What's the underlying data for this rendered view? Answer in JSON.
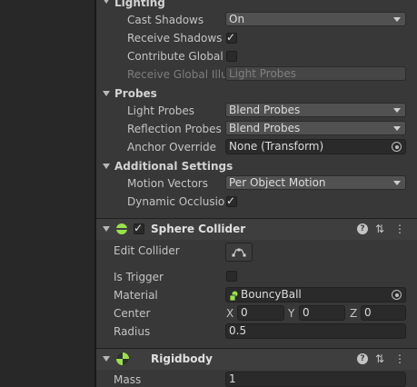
{
  "colors": {
    "accent_green": "#9be04d",
    "panel_bg": "#383838",
    "field_bg": "#2a2a2a"
  },
  "mesh_renderer": {
    "lighting": {
      "title": "Lighting",
      "cast_shadows": {
        "label": "Cast Shadows",
        "value": "On"
      },
      "receive_shadows": {
        "label": "Receive Shadows",
        "checked": true
      },
      "contribute_gi": {
        "label": "Contribute Global Il",
        "checked": false
      },
      "receive_gi": {
        "label": "Receive Global Illur",
        "value": "Light Probes"
      }
    },
    "probes": {
      "title": "Probes",
      "light_probes": {
        "label": "Light Probes",
        "value": "Blend Probes"
      },
      "reflection_probes": {
        "label": "Reflection Probes",
        "value": "Blend Probes"
      },
      "anchor_override": {
        "label": "Anchor Override",
        "value": "None (Transform)"
      }
    },
    "additional": {
      "title": "Additional Settings",
      "motion_vectors": {
        "label": "Motion Vectors",
        "value": "Per Object Motion"
      },
      "dynamic_occlusion": {
        "label": "Dynamic Occlusion",
        "checked": true
      }
    }
  },
  "sphere_collider": {
    "title": "Sphere Collider",
    "enabled": true,
    "edit_collider": {
      "label": "Edit Collider"
    },
    "is_trigger": {
      "label": "Is Trigger",
      "checked": false
    },
    "material": {
      "label": "Material",
      "value": "BouncyBall"
    },
    "center": {
      "label": "Center",
      "x_label": "X",
      "x": "0",
      "y_label": "Y",
      "y": "0",
      "z_label": "Z",
      "z": "0"
    },
    "radius": {
      "label": "Radius",
      "value": "0.5"
    }
  },
  "rigidbody": {
    "title": "Rigidbody",
    "mass": {
      "label": "Mass",
      "value": "1"
    }
  }
}
